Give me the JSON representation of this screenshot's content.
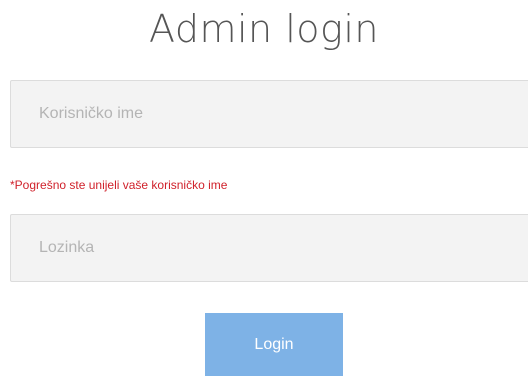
{
  "title": "Admin login",
  "username": {
    "value": "",
    "placeholder": "Korisničko ime"
  },
  "error": {
    "text": "*Pogrešno ste unijeli vaše korisničko ime",
    "color": "#d0212b"
  },
  "password": {
    "value": "",
    "placeholder": "Lozinka"
  },
  "login_button": {
    "label": "Login",
    "color": "#7eb2e6"
  }
}
